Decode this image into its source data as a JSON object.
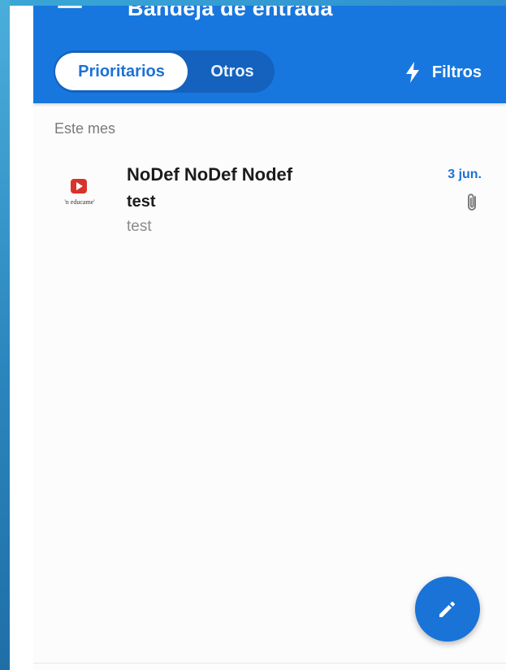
{
  "colors": {
    "appbar": "#1777df",
    "accent": "#1b72d6",
    "fab": "#1a73d6"
  },
  "header": {
    "title": "Bandeja de entrada",
    "tabs": [
      {
        "label": "Prioritarios",
        "selected": true
      },
      {
        "label": "Otros",
        "selected": false
      }
    ],
    "filters_label": "Filtros",
    "filters_icon": "lightning-bolt-icon",
    "menu_icon": "hamburger-menu-icon"
  },
  "inbox": {
    "section_label": "Este mes",
    "messages": [
      {
        "sender": "NoDef NoDef Nodef",
        "subject": "test",
        "preview": "test",
        "date": "3 jun.",
        "has_attachment": true,
        "avatar_text": "'n educame'",
        "avatar_icon": "play-logo-icon"
      }
    ]
  },
  "fab": {
    "icon": "pencil-icon"
  }
}
